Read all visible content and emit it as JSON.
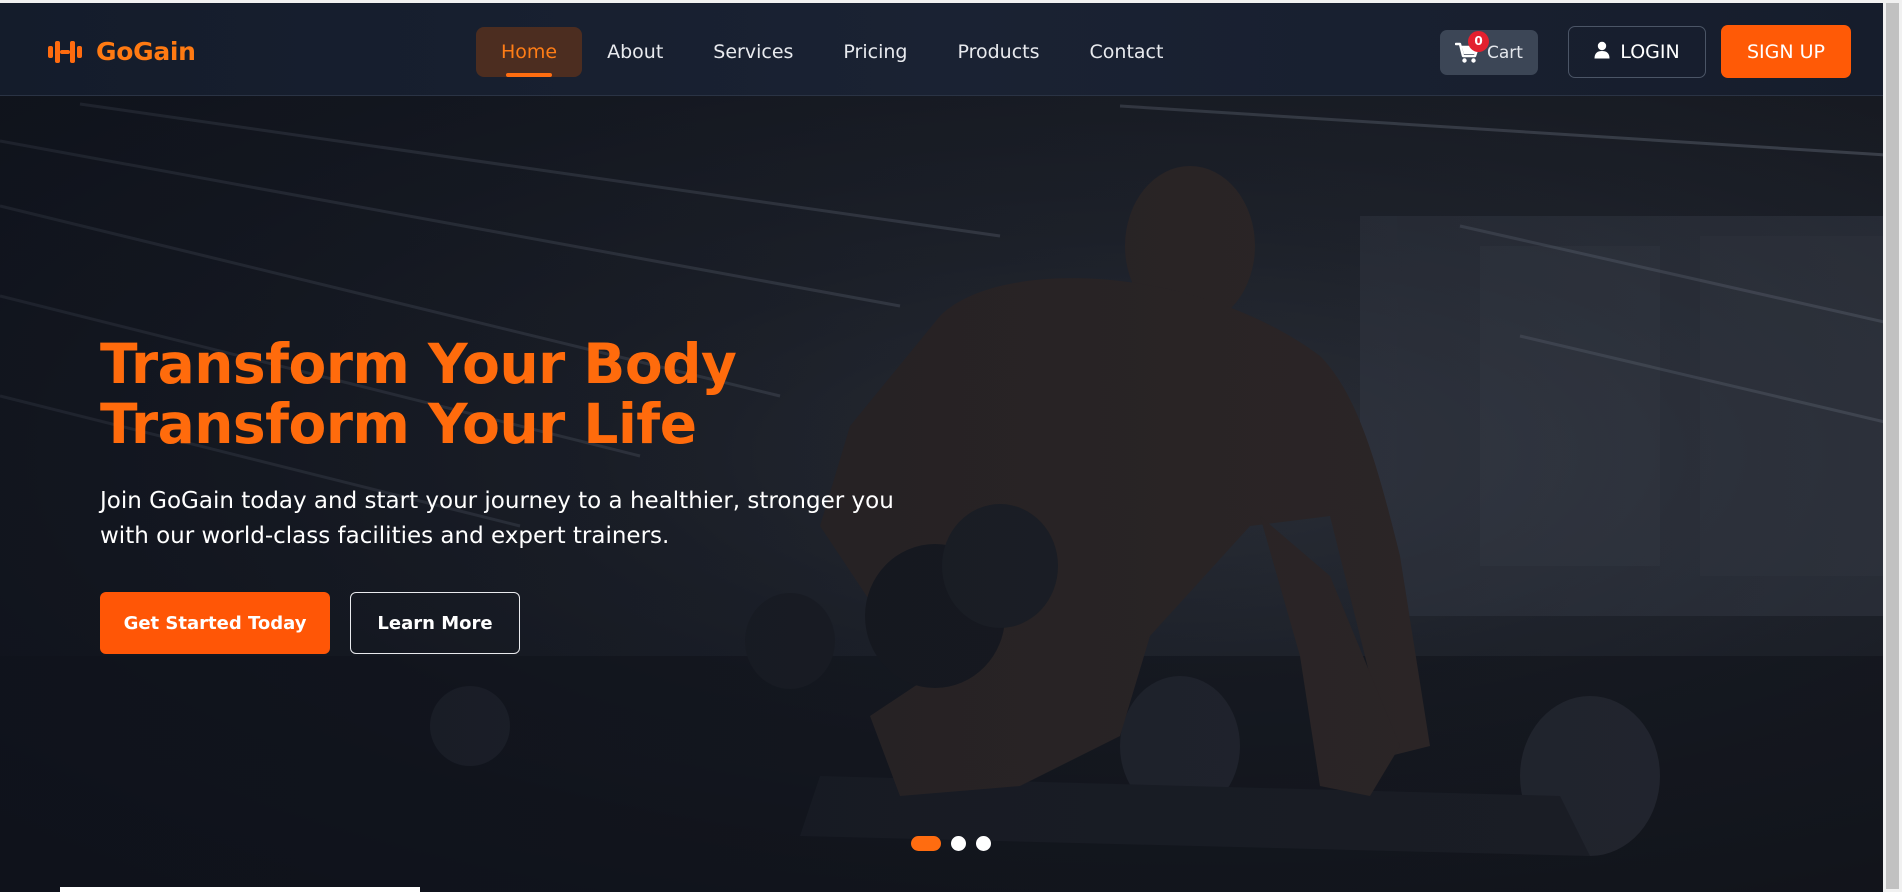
{
  "brand": {
    "name": "GoGain",
    "icon": "dumbbell-icon",
    "color": "#ff7a12"
  },
  "nav": {
    "items": [
      {
        "label": "Home",
        "active": true
      },
      {
        "label": "About",
        "active": false
      },
      {
        "label": "Services",
        "active": false
      },
      {
        "label": "Pricing",
        "active": false
      },
      {
        "label": "Products",
        "active": false
      },
      {
        "label": "Contact",
        "active": false
      }
    ]
  },
  "cart": {
    "label": "Cart",
    "count": "0",
    "icon": "shopping-cart-icon"
  },
  "auth": {
    "login_label": "LOGIN",
    "login_icon": "user-icon",
    "signup_label": "SIGN UP"
  },
  "hero": {
    "title_line1": "Transform Your Body",
    "title_line2": "Transform Your Life",
    "subtitle": "Join GoGain today and start your journey to a healthier, stronger you with our world-class facilities and expert trainers.",
    "primary_cta": "Get Started Today",
    "secondary_cta": "Learn More",
    "background": "gym-athlete-dumbbell-photo"
  },
  "carousel": {
    "slides": 3,
    "active_index": 0
  },
  "colors": {
    "accent": "#ff5a06",
    "accent_text": "#ff6b0c",
    "navbar_bg": "#161d2c",
    "cart_badge": "#e3202e"
  }
}
